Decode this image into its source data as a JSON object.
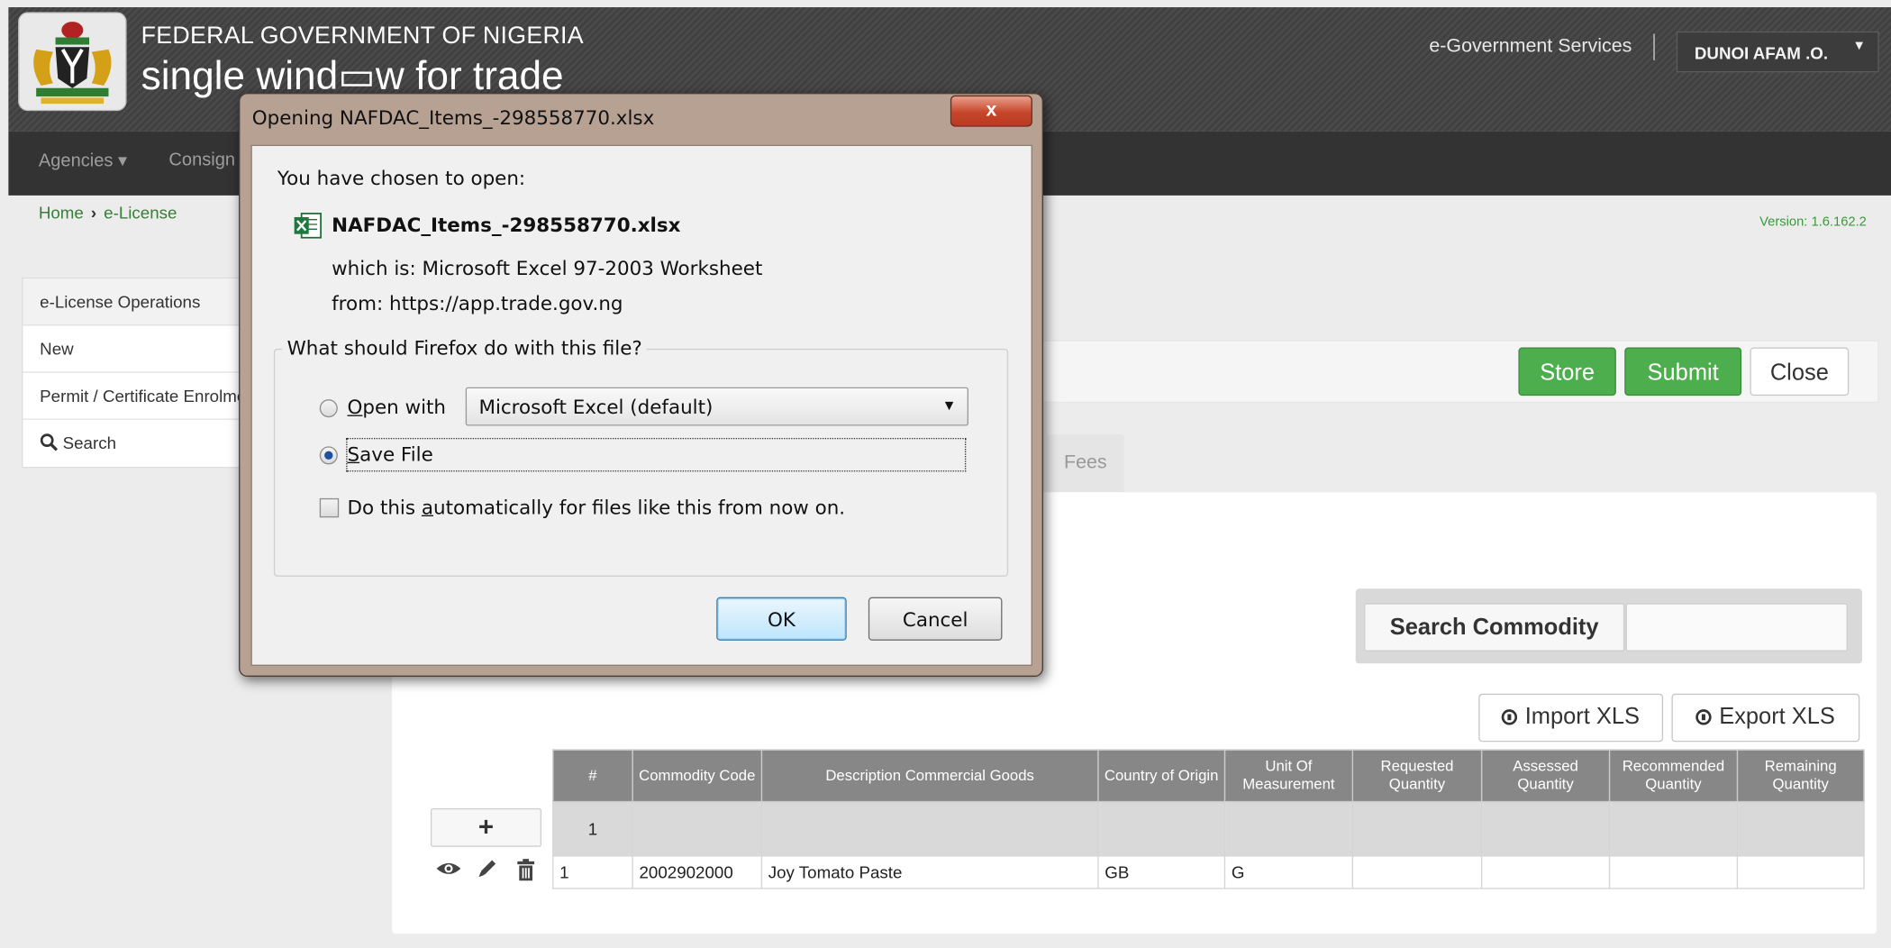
{
  "header": {
    "gov_title": "FEDERAL GOVERNMENT OF NIGERIA",
    "trade_title": "single wind▭w for trade",
    "egov_services": "e-Government Services",
    "user": "DUNOI AFAM .O."
  },
  "navbar": {
    "agencies": "Agencies ▾",
    "consign": "Consign"
  },
  "breadcrumb": {
    "home": "Home",
    "current": "e-License"
  },
  "version": "Version: 1.6.162.2",
  "sidemenu": {
    "operations": "e-License Operations",
    "new": "New",
    "permit": "Permit / Certificate Enrolment",
    "search": "Search"
  },
  "actions": {
    "store": "Store",
    "submit": "Submit",
    "close": "Close"
  },
  "tabs": {
    "fees": "Fees"
  },
  "search": {
    "button": "Search Commodity",
    "value": ""
  },
  "xls": {
    "import": "Import XLS",
    "export": "Export XLS"
  },
  "table": {
    "headers": [
      "#",
      "Commodity Code",
      "Description Commercial Goods",
      "Country of Origin",
      "Unit Of Measurement",
      "Requested Quantity",
      "Assessed Quantity",
      "Recommended Quantity",
      "Remaining Quantity"
    ],
    "filter_index": "1",
    "rows": [
      {
        "index": "1",
        "code": "2002902000",
        "desc": "Joy Tomato Paste",
        "country": "GB",
        "unit": "G",
        "requested": "",
        "assessed": "",
        "recommended": "",
        "remaining": ""
      }
    ],
    "add_label": "+"
  },
  "dialog": {
    "title": "Opening NAFDAC_Items_-298558770.xlsx",
    "close_glyph": "x",
    "chosen": "You have chosen to open:",
    "file_name": "NAFDAC_Items_-298558770.xlsx",
    "which_is_label": "which is:",
    "which_is_value": "Microsoft Excel 97-2003 Worksheet",
    "from_label": "from:",
    "from_value": "https://app.trade.gov.ng",
    "question": "What should Firefox do with this file?",
    "open_with_pre": "",
    "open_with_key": "O",
    "open_with_post": "pen with",
    "app_selected": "Microsoft Excel (default)",
    "save_key": "S",
    "save_post": "ave File",
    "auto_pre": "Do this ",
    "auto_key": "a",
    "auto_post": "utomatically for files like this from now on.",
    "ok": "OK",
    "cancel": "Cancel",
    "selected_option": "save"
  },
  "colors": {
    "green": "#4cae4c",
    "header_bg": "#444444",
    "navbar_bg": "#333333",
    "table_header": "#878787"
  }
}
